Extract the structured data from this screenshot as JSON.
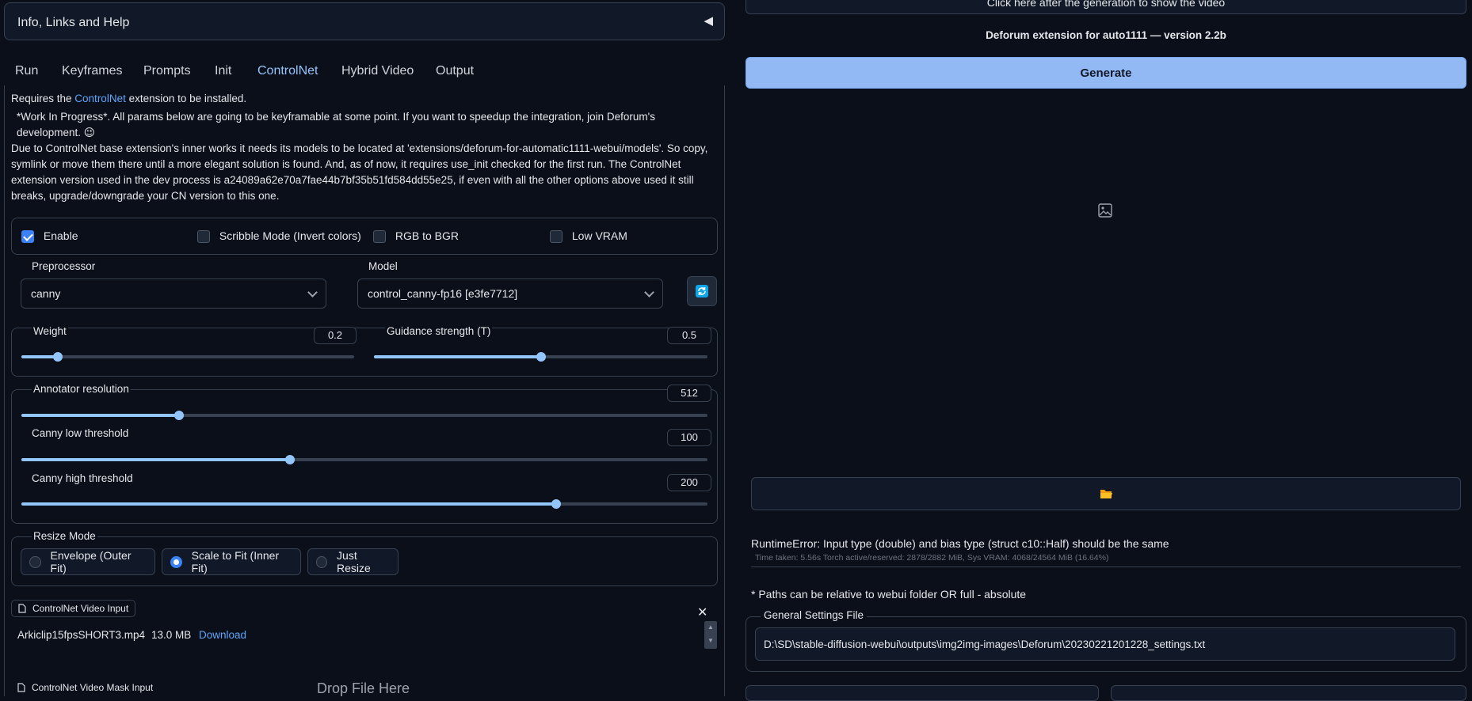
{
  "accordion": {
    "title": "Info, Links and Help",
    "arrow": "◀"
  },
  "tabs": [
    "Run",
    "Keyframes",
    "Prompts",
    "Init",
    "ControlNet",
    "Hybrid Video",
    "Output"
  ],
  "active_tab": "ControlNet",
  "info": {
    "requires_prefix": "Requires the ",
    "requires_link": "ControlNet",
    "requires_suffix": " extension to be installed.",
    "wip": "*Work In Progress*. All params below are going to be keyframable at some point. If you want to speedup the integration, join Deforum's development. 😉",
    "note": "Due to ControlNet base extension's inner works it needs its models to be located at 'extensions/deforum-for-automatic1111-webui/models'. So copy, symlink or move them there until a more elegant solution is found. And, as of now, it requires use_init checked for the first run. The ControlNet extension version used in the dev process is a24089a62e70a7fae44b7bf35b51fd584dd55e25, if even with all the other options above used it still breaks, upgrade/downgrade your CN version to this one."
  },
  "checkboxes": {
    "enable": {
      "label": "Enable",
      "checked": true
    },
    "scribble": {
      "label": "Scribble Mode (Invert colors)",
      "checked": false
    },
    "rgb_bgr": {
      "label": "RGB to BGR",
      "checked": false
    },
    "low_vram": {
      "label": "Low VRAM",
      "checked": false
    }
  },
  "preprocessor": {
    "label": "Preprocessor",
    "value": "canny"
  },
  "model": {
    "label": "Model",
    "value": "control_canny-fp16 [e3fe7712]"
  },
  "refresh_icon": "refresh-icon",
  "sliders": {
    "weight": {
      "label": "Weight",
      "value": "0.2",
      "fraction": 0.11
    },
    "guidance": {
      "label": "Guidance strength (T)",
      "value": "0.5",
      "fraction": 0.5
    },
    "annotator": {
      "label": "Annotator resolution",
      "value": "512",
      "fraction": 0.23
    },
    "canny_low": {
      "label": "Canny low threshold",
      "value": "100",
      "fraction": 0.392
    },
    "canny_high": {
      "label": "Canny high threshold",
      "value": "200",
      "fraction": 0.78
    }
  },
  "resize_mode": {
    "label": "Resize Mode",
    "options": [
      "Envelope (Outer Fit)",
      "Scale to Fit (Inner Fit)",
      "Just Resize"
    ],
    "selected": "Scale to Fit (Inner Fit)"
  },
  "video_input": {
    "label": "ControlNet Video Input",
    "filename": "Arkiclip15fpsSHORT3.mp4",
    "size": "13.0 MB",
    "download": "Download"
  },
  "mask_input": {
    "label": "ControlNet Video Mask Input",
    "drop": "Drop File Here"
  },
  "right": {
    "top_button": "Click here after the generation to show the video",
    "version": "Deforum extension for auto1111 — version 2.2b",
    "generate": "Generate",
    "error": "RuntimeError: Input type (double) and bias type (struct c10::Half) should be the same",
    "meta": "Time taken: 5.56s  Torch active/reserved: 2878/2882 MiB, Sys VRAM: 4068/24564 MiB (16.64%)",
    "paths_note": "* Paths can be relative to webui folder OR full - absolute",
    "settings_label": "General Settings File",
    "settings_value": "D:\\SD\\stable-diffusion-webui\\outputs\\img2img-images\\Deforum\\20230221201228_settings.txt"
  },
  "colors": {
    "accent": "#93c5fd",
    "generate": "#93b9f5",
    "bg": "#0b0f19",
    "border": "#374151"
  }
}
